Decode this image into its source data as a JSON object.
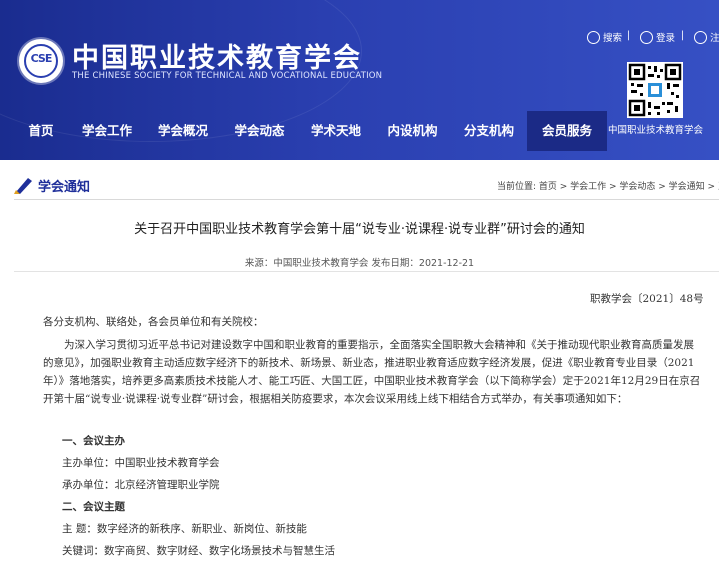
{
  "site": {
    "title": "中国职业技术教育学会",
    "subtitle": "THE CHINESE SOCIETY FOR TECHNICAL AND VOCATIONAL EDUCATION",
    "logo_text": "CSE"
  },
  "utility": {
    "search_label": "搜索",
    "login_label": "登录",
    "register_label": "注"
  },
  "nav": {
    "items": [
      "首页",
      "学会工作",
      "学会概况",
      "学会动态",
      "学术天地",
      "内设机构",
      "分支机构",
      "会员服务"
    ],
    "active_index": 7,
    "extra": "中国职业技术教育学会"
  },
  "section": {
    "title": "学会通知",
    "breadcrumb": "当前位置: 首页 > 学会工作 > 学会动态 > 学会通知 > 正文"
  },
  "article": {
    "title": "关于召开中国职业技术教育学会第十届“说专业·说课程·说专业群”研讨会的通知",
    "meta": "来源：中国职业技术教育学会   发布日期：2021-12-21",
    "doc_no": "职教学会〔2021〕48号",
    "salutation": "各分支机构、联络处，各会员单位和有关院校：",
    "paragraph": "为深入学习贯彻习近平总书记对建设数字中国和职业教育的重要指示，全面落实全国职教大会精神和《关于推动现代职业教育高质量发展的意见》，加强职业教育主动适应数字经济下的新技术、新场景、新业态，推进职业教育适应数字经济发展，促进《职业教育专业目录（2021年）》落地落实，培养更多高素质技术技能人才、能工巧匠、大国工匠，中国职业技术教育学会（以下简称学会）定于2021年12月29日在京召开第十届“说专业·说课程·说专业群”研讨会，根据相关防疫要求，本次会议采用线上线下相结合方式举办，有关事项通知如下：",
    "section1_heading": "一、会议主办",
    "host": "主办单位：中国职业技术教育学会",
    "organizer": "承办单位：北京经济管理职业学院",
    "section2_heading": "二、会议主题",
    "theme": "主    题：数字经济的新秩序、新职业、新岗位、新技能",
    "keywords": "关键词：数字商贸、数字财经、数字化场景技术与智慧生活"
  },
  "colors": {
    "header_blue": "#2a3fb0",
    "nav_active": "#1b2a86",
    "section_title": "#1f2f9a"
  }
}
